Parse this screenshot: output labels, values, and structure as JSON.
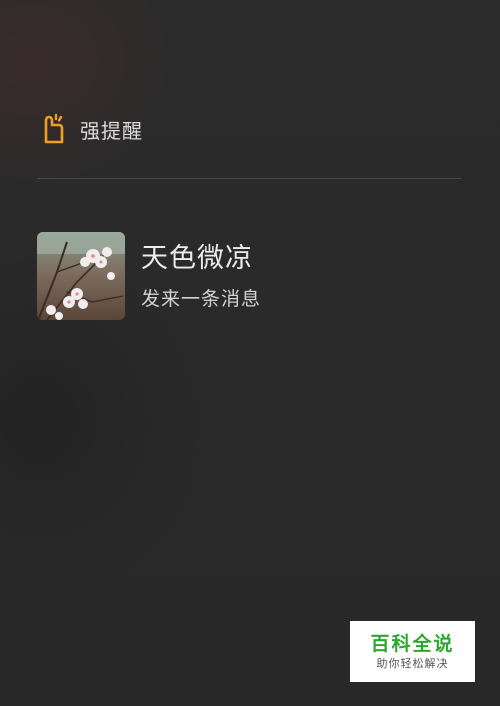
{
  "header": {
    "icon": "hand-tap-icon",
    "title": "强提醒",
    "accent_color": "#f0a020"
  },
  "message": {
    "sender": "天色微凉",
    "preview": "发来一条消息",
    "avatar_icon": "blossom-photo"
  },
  "watermark": {
    "title": "百科全说",
    "subtitle": "助你轻松解决",
    "color": "#2ea72e"
  }
}
